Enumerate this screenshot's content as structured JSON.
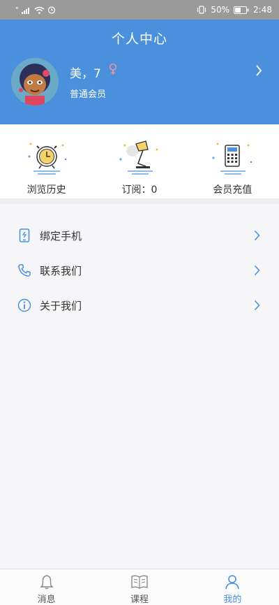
{
  "status_bar": {
    "carrier_mark": "\"",
    "battery_percent": "50%",
    "time": "2:48",
    "icons": [
      "signal-icon",
      "wifi-icon",
      "alarm-icon",
      "vibrate-icon",
      "battery-icon"
    ]
  },
  "header": {
    "title": "个人中心",
    "user_name": "美，7",
    "member_level": "普通会员",
    "gender_icon": "female-icon",
    "accent_color": "#4a90dc"
  },
  "quick_actions": [
    {
      "label": "浏览历史",
      "icon": "alarm-clock-icon"
    },
    {
      "label": "订阅：0",
      "icon": "desk-lamp-icon"
    },
    {
      "label": "会员充值",
      "icon": "calculator-icon"
    }
  ],
  "menu": [
    {
      "label": "绑定手机",
      "icon": "phone-icon"
    },
    {
      "label": "联系我们",
      "icon": "telephone-icon"
    },
    {
      "label": "关于我们",
      "icon": "info-icon"
    }
  ],
  "bottom_nav": {
    "items": [
      {
        "label": "消息",
        "icon": "bell-icon"
      },
      {
        "label": "课程",
        "icon": "book-icon"
      },
      {
        "label": "我的",
        "icon": "user-icon"
      }
    ],
    "active_color": "#4a90dc"
  }
}
